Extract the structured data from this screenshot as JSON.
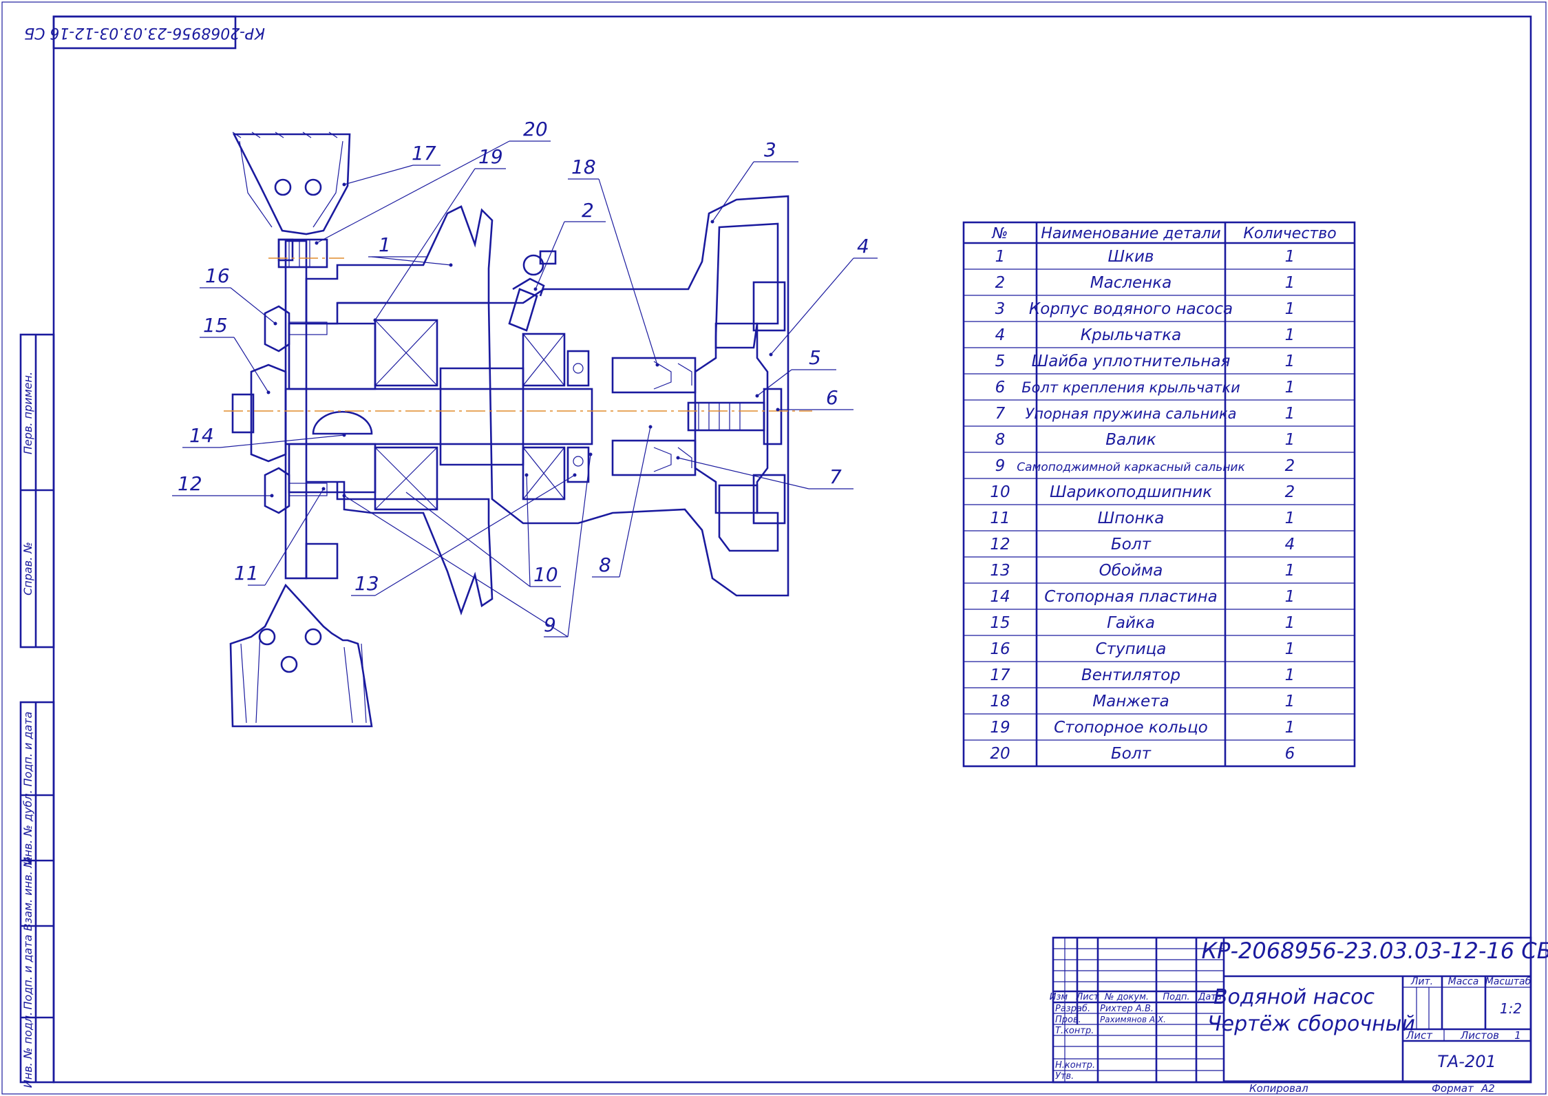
{
  "frame_stamp": "КР-2068956-23.03.03-12-16 СБ",
  "side_stamps": [
    "Перв. примен.",
    "Справ. №",
    "Подп. и дата",
    "Инв. № дубл.",
    "Взам. инв. №",
    "Подп. и дата",
    "Инв. № подл."
  ],
  "callouts": [
    "1",
    "2",
    "3",
    "4",
    "5",
    "6",
    "7",
    "8",
    "9",
    "10",
    "11",
    "12",
    "13",
    "14",
    "15",
    "16",
    "17",
    "18",
    "19",
    "20"
  ],
  "parts_table": {
    "headers": [
      "№",
      "Наименование детали",
      "Количество"
    ],
    "rows": [
      {
        "n": "1",
        "name": "Шкив",
        "qty": "1"
      },
      {
        "n": "2",
        "name": "Масленка",
        "qty": "1"
      },
      {
        "n": "3",
        "name": "Корпус водяного насоса",
        "qty": "1"
      },
      {
        "n": "4",
        "name": "Крыльчатка",
        "qty": "1"
      },
      {
        "n": "5",
        "name": "Шайба уплотнительная",
        "qty": "1"
      },
      {
        "n": "6",
        "name": "Болт крепления крыльчатки",
        "qty": "1"
      },
      {
        "n": "7",
        "name": "Упорная пружина сальника",
        "qty": "1"
      },
      {
        "n": "8",
        "name": "Валик",
        "qty": "1"
      },
      {
        "n": "9",
        "name": "Самоподжимной каркасный сальник",
        "qty": "2"
      },
      {
        "n": "10",
        "name": "Шарикоподшипник",
        "qty": "2"
      },
      {
        "n": "11",
        "name": "Шпонка",
        "qty": "1"
      },
      {
        "n": "12",
        "name": "Болт",
        "qty": "4"
      },
      {
        "n": "13",
        "name": "Обойма",
        "qty": "1"
      },
      {
        "n": "14",
        "name": "Стопорная пластина",
        "qty": "1"
      },
      {
        "n": "15",
        "name": "Гайка",
        "qty": "1"
      },
      {
        "n": "16",
        "name": "Ступица",
        "qty": "1"
      },
      {
        "n": "17",
        "name": "Вентилятор",
        "qty": "1"
      },
      {
        "n": "18",
        "name": "Манжета",
        "qty": "1"
      },
      {
        "n": "19",
        "name": "Стопорное кольцо",
        "qty": "1"
      },
      {
        "n": "20",
        "name": "Болт",
        "qty": "6"
      }
    ]
  },
  "title_block": {
    "designation": "КР-2068956-23.03.03-12-16 СБ",
    "title_line1": "Водяной насос",
    "title_line2": "Чертёж сборочный",
    "hdr_izm": "Изм",
    "hdr_list": "Лист",
    "hdr_doc": "№ докум.",
    "hdr_podp": "Подп.",
    "hdr_data": "Дата",
    "role_razrab": "Разраб.",
    "role_prov": "Пров.",
    "role_tkontr": "Т.контр.",
    "role_nkontr": "Н.контр.",
    "role_utv": "Утв.",
    "name_razrab": "Рихтер А.В.",
    "name_prov": "Рахимянов А.Х.",
    "lit_label": "Лит.",
    "mass_label": "Масса",
    "scale_label": "Масштаб",
    "scale_value": "1:2",
    "sheet_label": "Лист",
    "sheets_label": "Листов",
    "sheets_value": "1",
    "group": "ТА-201",
    "copied": "Копировал",
    "format_label": "Формат",
    "format_value": "А2"
  }
}
